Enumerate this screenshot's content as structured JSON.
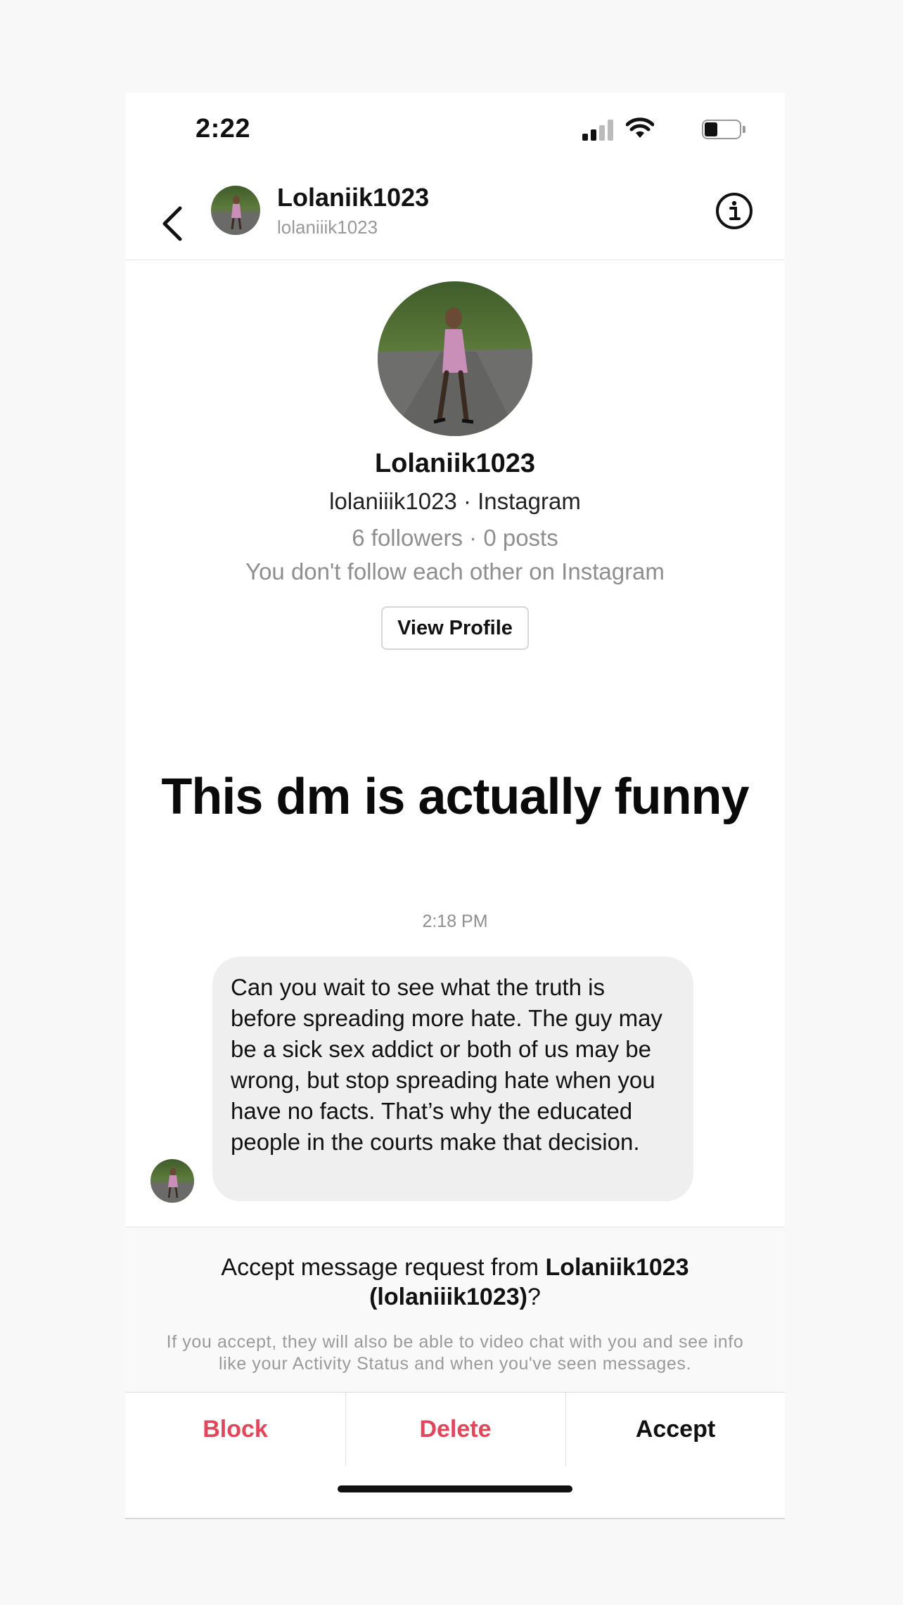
{
  "status_bar": {
    "time": "2:22"
  },
  "header": {
    "title": "Lolaniik1023",
    "subtitle": "lolaniiik1023"
  },
  "profile": {
    "name": "Lolaniik1023",
    "handle_line": "lolaniiik1023 · Instagram",
    "stats_line": "6 followers · 0 posts",
    "follow_line": "You don't follow each other on Instagram",
    "view_profile_label": "View Profile"
  },
  "caption": "This dm is actually funny",
  "message": {
    "timestamp": "2:18 PM",
    "text": "Can you wait to see what the truth is before spreading more hate. The guy may be a sick sex addict or both of us may be wrong, but stop spreading hate when you have no facts. That’s why the educated people in the courts make that decision."
  },
  "request": {
    "prefix": "Accept message request from ",
    "name": "Lolaniik1023",
    "handle": "(lolaniiik1023)",
    "suffix": "?",
    "note": "If you accept, they will also be able to video chat with you and see info like your Activity Status and when you've seen messages."
  },
  "actions": {
    "block_label": "Block",
    "delete_label": "Delete",
    "accept_label": "Accept"
  },
  "colors": {
    "destructive": "#e0475b",
    "bubble": "#efefef",
    "muted_text": "#8e8e8e"
  },
  "icons": {
    "back": "chevron-left-icon",
    "info": "info-circle-icon",
    "signal": "cellular-signal-icon",
    "wifi": "wifi-icon",
    "battery": "battery-icon"
  }
}
